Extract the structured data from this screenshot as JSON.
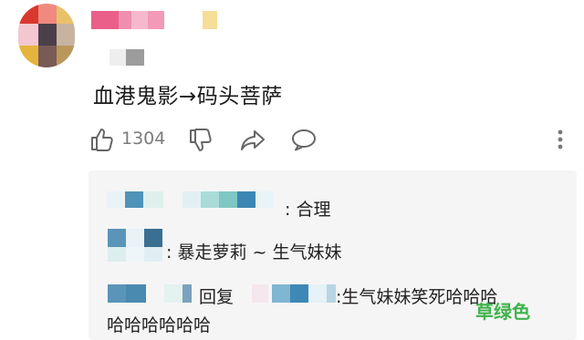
{
  "comment": {
    "text": "血港鬼影→码头菩萨",
    "like_count": "1304"
  },
  "actions": {
    "like_icon": "thumbs-up-icon",
    "dislike_icon": "thumbs-down-icon",
    "share_icon": "share-icon",
    "reply_icon": "comment-bubble-icon",
    "more_icon": "more-vertical-icon"
  },
  "replies": [
    {
      "text": ": 合理"
    },
    {
      "text": ": 暴走萝莉 ~ 生气妹妹"
    },
    {
      "reply_word": "回复",
      "text": ":生气妹妹笑死哈哈哈",
      "continuation": "哈哈哈哈哈哈"
    }
  ],
  "watermark": "草绿色",
  "colors": {
    "like_count": "#7b7b7b",
    "reply_background": "#f5f5f5",
    "watermark": "#3fb24a",
    "username_pink": "#e8739a"
  }
}
